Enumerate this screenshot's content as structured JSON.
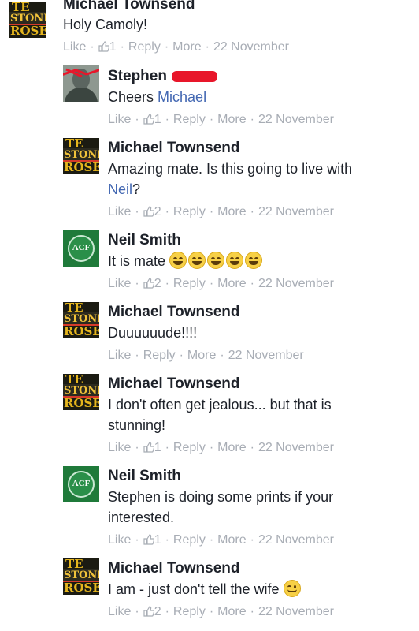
{
  "comments": [
    {
      "author": "Michael Townsend",
      "text": "Holy Camoly!",
      "likes": "1",
      "actions": {
        "like": "Like",
        "reply": "Reply",
        "more": "More"
      },
      "date": "22 November"
    },
    {
      "author": "Stephen",
      "text": "Cheers",
      "mention": "Michael",
      "likes": "1",
      "actions": {
        "like": "Like",
        "reply": "Reply",
        "more": "More"
      },
      "date": "22 November"
    },
    {
      "author": "Michael Townsend",
      "text": "Amazing mate. Is this going to live with",
      "text2_mention": "Neil",
      "text2_suffix": "?",
      "likes": "2",
      "actions": {
        "like": "Like",
        "reply": "Reply",
        "more": "More"
      },
      "date": "22 November"
    },
    {
      "author": "Neil Smith",
      "text": "It is mate",
      "emoji": "grinning-face",
      "emoji_count": 5,
      "likes": "2",
      "actions": {
        "like": "Like",
        "reply": "Reply",
        "more": "More"
      },
      "date": "22 November"
    },
    {
      "author": "Michael Townsend",
      "text": "Duuuuuude!!!!",
      "actions": {
        "like": "Like",
        "reply": "Reply",
        "more": "More"
      },
      "date": "22 November"
    },
    {
      "author": "Michael Townsend",
      "text": "I don't often get jealous... but that is",
      "text2": "stunning!",
      "likes": "1",
      "actions": {
        "like": "Like",
        "reply": "Reply",
        "more": "More"
      },
      "date": "22 November"
    },
    {
      "author": "Neil Smith",
      "text": "Stephen is doing some prints if your",
      "text2": "interested.",
      "likes": "1",
      "actions": {
        "like": "Like",
        "reply": "Reply",
        "more": "More"
      },
      "date": "22 November"
    },
    {
      "author": "Michael Townsend",
      "text": "I am - just don't tell the wife",
      "emoji": "winking-face",
      "likes": "2",
      "actions": {
        "like": "Like",
        "reply": "Reply",
        "more": "More"
      },
      "date": "22 November"
    }
  ],
  "colors": {
    "mention": "#4267b2",
    "meta": "#a8adb5",
    "name": "#1d2129",
    "redaction": "#e8162a"
  }
}
